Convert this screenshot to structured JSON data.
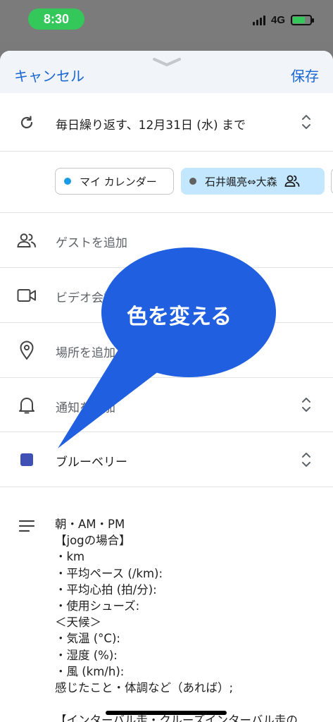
{
  "status_bar": {
    "time": "8:30",
    "network": "4G",
    "colors": {
      "time_pill": "#34c759"
    }
  },
  "header": {
    "cancel_label": "キャンセル",
    "save_label": "保存",
    "grabber_icon": "chevron-down-icon"
  },
  "repeat": {
    "icon": "refresh-icon",
    "label": "毎日繰り返す、12月31日 (水) まで"
  },
  "calendars": {
    "items": [
      {
        "label": "マイ カレンダー",
        "dot_color": "#1a9be6",
        "selected": false
      },
      {
        "label": "石井颯亮⇔大森",
        "dot_color": "#616161",
        "selected": true,
        "icon": "people-icon"
      }
    ]
  },
  "guests": {
    "icon": "people-icon",
    "label": "ゲストを追加"
  },
  "video": {
    "icon": "video-icon",
    "label": "ビデオ会議"
  },
  "location": {
    "icon": "location-pin-icon",
    "label": "場所を追加"
  },
  "notification": {
    "icon": "bell-icon",
    "label": "通知を追加"
  },
  "color": {
    "swatch": "#3f51b5",
    "label": "ブルーベリー"
  },
  "description": {
    "icon": "notes-icon",
    "text": "朝・AM・PM\n【jogの場合】\n・km\n・平均ペース (/km):\n・平均心拍 (拍/分):\n・使用シューズ:\n＜天候＞\n・気温 (°C):\n・湿度 (%):\n・風 (km/h):\n感じたこと・体調など（あれば）;\n\n【インターバル走・クルーズインターバル走の"
  },
  "annotation": {
    "text": "色を変える",
    "color": "#1f5fe0"
  }
}
